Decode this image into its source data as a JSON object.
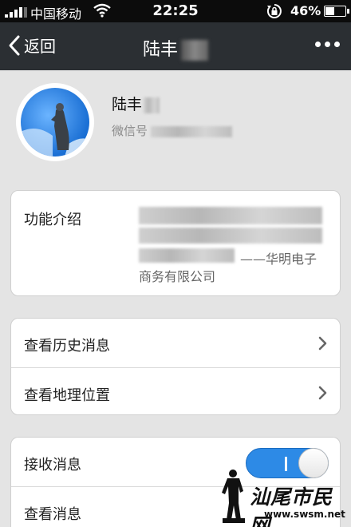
{
  "status_bar": {
    "carrier": "中国移动",
    "time": "22:25",
    "battery_percent": "46%",
    "battery_level": 0.46
  },
  "nav": {
    "back_label": "返回",
    "title": "陆丰"
  },
  "profile": {
    "name": "陆丰",
    "wechat_id_label": "微信号"
  },
  "intro": {
    "label": "功能介绍",
    "text_tail": "——华明电子",
    "text_line2": "商务有限公司"
  },
  "menu": {
    "items": [
      {
        "label": "查看历史消息",
        "icon": "chevron-right-icon"
      },
      {
        "label": "查看地理位置",
        "icon": "chevron-right-icon"
      }
    ]
  },
  "settings": {
    "receive_label": "接收消息",
    "receive_on": true,
    "view_label": "查看消息"
  },
  "watermark": {
    "text": "汕尾市民网",
    "url": "www.swsm.net"
  },
  "colors": {
    "nav_bg": "#2b2f33",
    "toggle_on": "#2d8ae6",
    "page_bg": "#e4e4e4"
  }
}
